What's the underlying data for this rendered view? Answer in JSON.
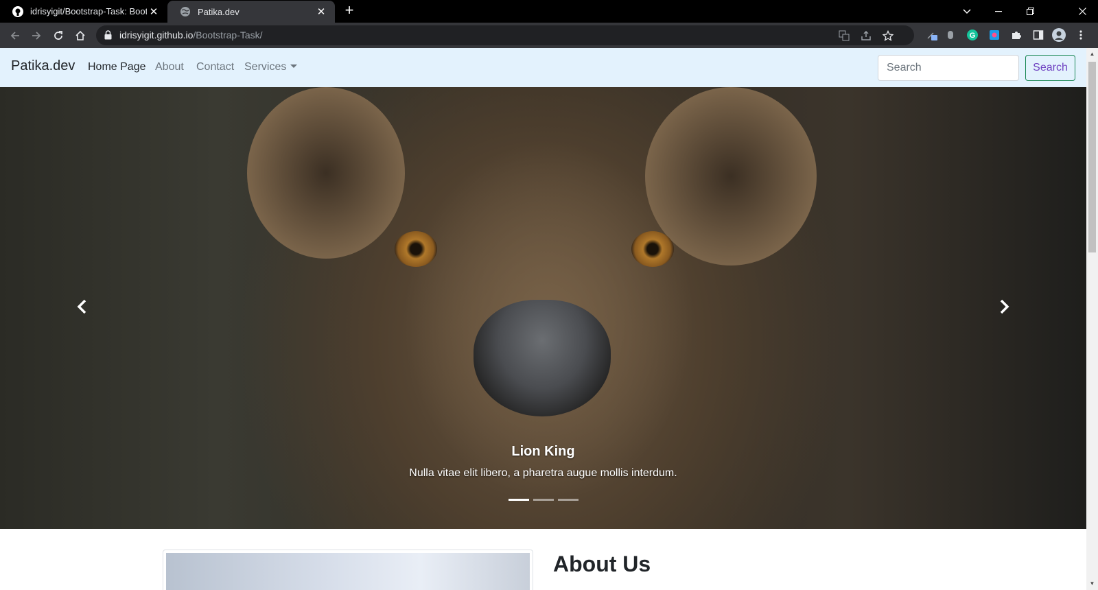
{
  "browser": {
    "tabs": [
      {
        "title": "idrisyigit/Bootstrap-Task: Bootstr",
        "icon": "github-icon",
        "active": false
      },
      {
        "title": "Patika.dev",
        "icon": "globe-icon",
        "active": true
      }
    ],
    "url": {
      "host": "idrisyigit.github.io",
      "path": "/Bootstrap-Task/"
    }
  },
  "navbar": {
    "brand": "Patika.dev",
    "links": [
      "Home Page",
      "About",
      "Contact",
      "Services"
    ],
    "active_link": "Home Page",
    "search_placeholder": "Search",
    "search_button": "Search"
  },
  "carousel": {
    "caption_title": "Lion King",
    "caption_text": "Nulla vitae elit libero, a pharetra augue mollis interdum.",
    "slides_count": 3,
    "active_slide": 1
  },
  "about": {
    "title": "About Us"
  },
  "colors": {
    "navbar_bg": "#e3f2fd",
    "search_button_border": "#198754",
    "search_button_text": "#6f42c1"
  }
}
